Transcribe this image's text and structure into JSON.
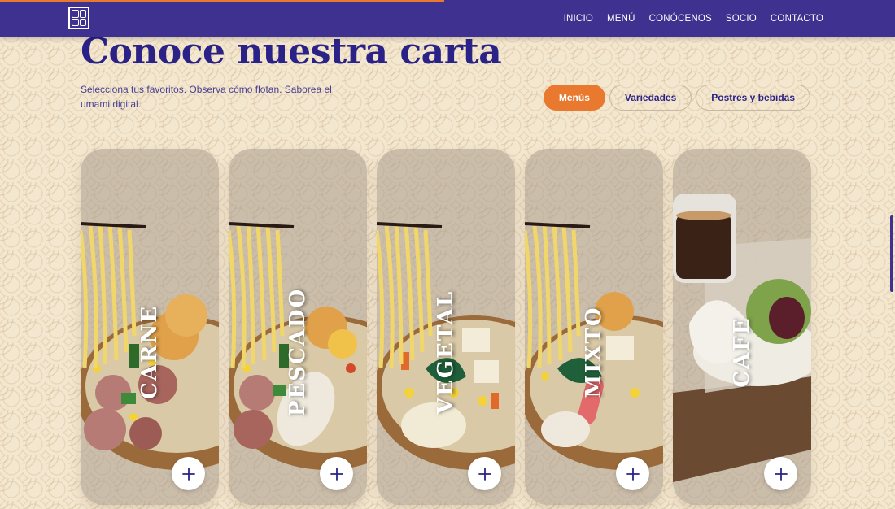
{
  "colors": {
    "nav_bg": "#3f318f",
    "accent": "#e8792e",
    "title": "#2a2286",
    "page_bg": "#f4e7cf"
  },
  "nav": {
    "logo": "udon-logo",
    "items": [
      "INICIO",
      "MENÚ",
      "CONÓCENOS",
      "SOCIO",
      "CONTACTO"
    ]
  },
  "scroll_progress": 0.5,
  "section": {
    "title": "Conoce nuestra carta",
    "subtitle": "Selecciona tus favoritos. Observa cómo flotan. Saborea el umami digital."
  },
  "filters": {
    "selected": "Menús",
    "items": [
      "Menús",
      "Variedades",
      "Postres y bebidas"
    ]
  },
  "cards": [
    {
      "label": "CARNE",
      "image": "ramen-carne",
      "icon": "plus-icon"
    },
    {
      "label": "PESCADO",
      "image": "ramen-pescado",
      "icon": "plus-icon"
    },
    {
      "label": "VEGETAL",
      "image": "ramen-vegetal",
      "icon": "plus-icon"
    },
    {
      "label": "MIXTO",
      "image": "ramen-mixto",
      "icon": "plus-icon"
    },
    {
      "label": "CAFE",
      "image": "coffee-and-bao",
      "icon": "plus-icon"
    }
  ]
}
